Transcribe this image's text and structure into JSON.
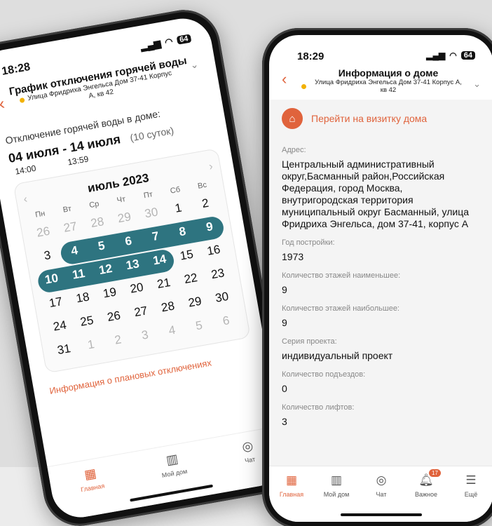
{
  "left_phone": {
    "status_time": "18:28",
    "battery": "64",
    "header_title": "График отключения горячей воды",
    "header_subtitle": "Улица Фридриха Энгельса Дом 37-41 Корпус А, кв 42",
    "body_label": "Отключение горячей воды в доме:",
    "date_range": "04 июля - 14 июля",
    "days_count": "(10 суток)",
    "start_time": "14:00",
    "end_time": "13:59",
    "calendar": {
      "month": "июль 2023",
      "weekdays": [
        "Пн",
        "Вт",
        "Ср",
        "Чт",
        "Пт",
        "Сб",
        "Вс"
      ],
      "days": [
        {
          "d": "26",
          "muted": true
        },
        {
          "d": "27",
          "muted": true
        },
        {
          "d": "28",
          "muted": true
        },
        {
          "d": "29",
          "muted": true
        },
        {
          "d": "30",
          "muted": true
        },
        {
          "d": "1"
        },
        {
          "d": "2"
        },
        {
          "d": "3"
        },
        {
          "d": "4",
          "sel": true
        },
        {
          "d": "5",
          "sel": true
        },
        {
          "d": "6",
          "sel": true
        },
        {
          "d": "7",
          "sel": true
        },
        {
          "d": "8",
          "sel": true
        },
        {
          "d": "9",
          "sel": true
        },
        {
          "d": "10",
          "sel": true
        },
        {
          "d": "11",
          "sel": true
        },
        {
          "d": "12",
          "sel": true
        },
        {
          "d": "13",
          "sel": true
        },
        {
          "d": "14",
          "sel": true
        },
        {
          "d": "15"
        },
        {
          "d": "16"
        },
        {
          "d": "17"
        },
        {
          "d": "18"
        },
        {
          "d": "19"
        },
        {
          "d": "20"
        },
        {
          "d": "21"
        },
        {
          "d": "22"
        },
        {
          "d": "23"
        },
        {
          "d": "24"
        },
        {
          "d": "25"
        },
        {
          "d": "26"
        },
        {
          "d": "27"
        },
        {
          "d": "28"
        },
        {
          "d": "29"
        },
        {
          "d": "30"
        },
        {
          "d": "31"
        },
        {
          "d": "1",
          "muted": true
        },
        {
          "d": "2",
          "muted": true
        },
        {
          "d": "3",
          "muted": true
        },
        {
          "d": "4",
          "muted": true
        },
        {
          "d": "5",
          "muted": true
        },
        {
          "d": "6",
          "muted": true
        }
      ]
    },
    "info_link": "Информация о плановых отключениях",
    "tabs": [
      {
        "label": "Главная",
        "icon": "grid-icon",
        "active": true
      },
      {
        "label": "Мой дом",
        "icon": "building-icon"
      },
      {
        "label": "Чат",
        "icon": "chat-icon"
      }
    ]
  },
  "right_phone": {
    "status_time": "18:29",
    "battery": "64",
    "title": "Информация о доме",
    "subtitle": "Улица Фридриха Энгельса Дом 37-41 Корпус А, кв 42",
    "visit_link": "Перейти на визитку дома",
    "fields": [
      {
        "label": "Адрес:",
        "value": "Центральный административный округ,Басманный район,Российская Федерация, город Москва, внутригородская территория муниципальный округ Басманный, улица Фридриха Энгельса, дом 37-41, корпус А"
      },
      {
        "label": "Год постройки:",
        "value": "1973"
      },
      {
        "label": "Количество этажей наименьшее:",
        "value": "9"
      },
      {
        "label": "Количество этажей наибольшее:",
        "value": "9"
      },
      {
        "label": "Серия проекта:",
        "value": "индивидуальный проект"
      },
      {
        "label": "Количество подъездов:",
        "value": "0"
      },
      {
        "label": "Количество лифтов:",
        "value": "3"
      }
    ],
    "tabs": [
      {
        "label": "Главная",
        "icon": "grid-icon",
        "active": true
      },
      {
        "label": "Мой дом",
        "icon": "building-icon"
      },
      {
        "label": "Чат",
        "icon": "chat-icon"
      },
      {
        "label": "Важное",
        "icon": "bell-icon",
        "badge": "17"
      },
      {
        "label": "Ещё",
        "icon": "menu-icon"
      }
    ],
    "accent_color": "#e0633c",
    "selection_color": "#2e7480"
  }
}
